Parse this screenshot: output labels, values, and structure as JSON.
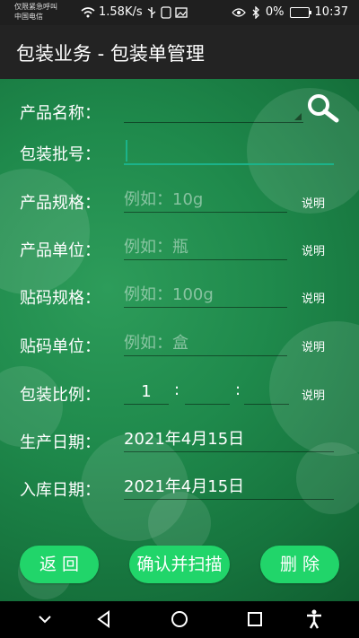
{
  "status_bar": {
    "carrier_line1": "仅限紧急呼叫",
    "carrier_line2": "中国电信",
    "net_speed": "1.58K/s",
    "battery": "0%",
    "time": "10:37"
  },
  "header": {
    "title": "包装业务 - 包装单管理"
  },
  "form": {
    "product_name_label": "产品名称：",
    "product_name_value": "",
    "batch_label": "包装批号：",
    "batch_value": "",
    "spec_label": "产品规格：",
    "spec_placeholder": "例如：10g",
    "unit_label": "产品单位：",
    "unit_placeholder": "例如：瓶",
    "code_spec_label": "贴码规格：",
    "code_spec_placeholder": "例如：100g",
    "code_unit_label": "贴码单位：",
    "code_unit_placeholder": "例如：盒",
    "ratio_label": "包装比例：",
    "ratio_first": "1",
    "ratio_colon": ":",
    "production_date_label": "生产日期：",
    "production_date": "2021年4月15日",
    "storage_date_label": "入库日期：",
    "storage_date": "2021年4月15日",
    "note": "说明"
  },
  "buttons": {
    "back": "返 回",
    "confirm_scan": "确认并扫描",
    "delete": "删 除"
  },
  "colors": {
    "accent": "#21d56a",
    "background": "#1f8a4c",
    "header": "#232323"
  }
}
